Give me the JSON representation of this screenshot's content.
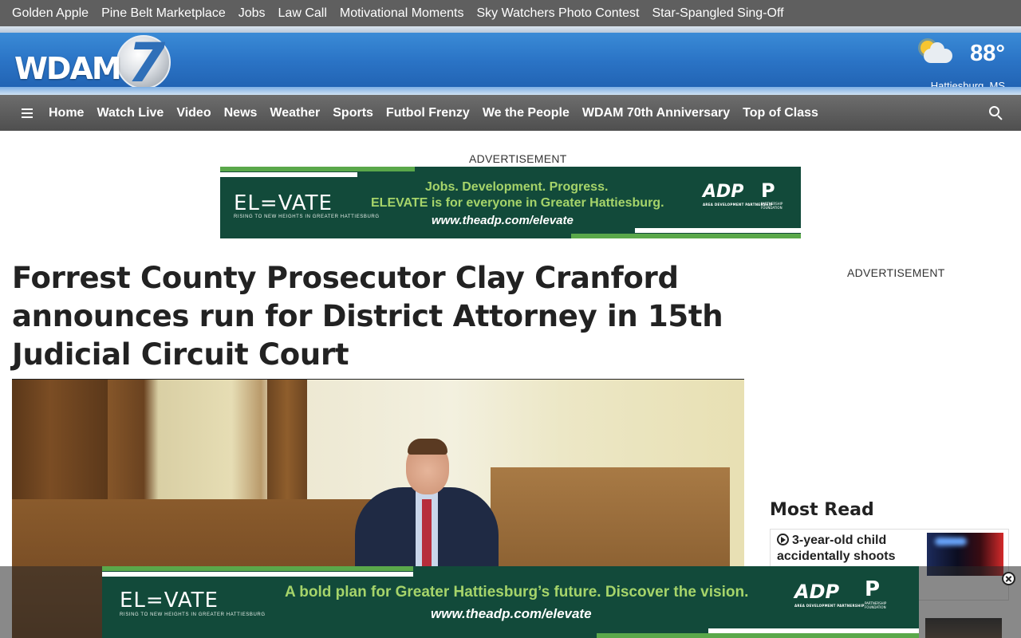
{
  "top_links": [
    "Golden Apple",
    "Pine Belt Marketplace",
    "Jobs",
    "Law Call",
    "Motivational Moments",
    "Sky Watchers Photo Contest",
    "Star-Spangled Sing-Off"
  ],
  "brand": {
    "logo_text": "WDAM",
    "logo_number": "7"
  },
  "weather": {
    "temperature": "88°",
    "location": "Hattiesburg, MS",
    "icon": "partly-cloudy-icon"
  },
  "nav": {
    "menu_icon": "hamburger-menu-icon",
    "items": [
      "Home",
      "Watch Live",
      "Video",
      "News",
      "Weather",
      "Sports",
      "Futbol Frenzy",
      "We the People",
      "WDAM 70th Anniversary",
      "Top of Class"
    ],
    "search_icon": "search-icon"
  },
  "top_ad": {
    "label": "ADVERTISEMENT",
    "brand": "EL=VATE",
    "tagline": "RISING TO NEW HEIGHTS IN GREATER HATTIESBURG",
    "line1": "Jobs. Development. Progress.",
    "line2": "ELEVATE is for everyone in Greater Hattiesburg.",
    "url": "www.theadp.com/elevate",
    "adp": "ADP",
    "adp_sub": "AREA DEVELOPMENT PARTNERSHIP",
    "pf": "P",
    "pf_sub": "PARTNERSHIP FOUNDATION"
  },
  "article": {
    "headline": "Forrest County Prosecutor Clay Cranford announces run for District Attorney in 15th Judicial Circuit Court"
  },
  "sidebar": {
    "ad_label": "ADVERTISEMENT",
    "most_read_title": "Most Read",
    "most_read_items": [
      {
        "title": "3-year-old child accidentally shoots",
        "icon": "play-circle-icon"
      }
    ]
  },
  "sticky_ad": {
    "brand": "EL=VATE",
    "tagline": "RISING TO NEW HEIGHTS IN GREATER HATTIESBURG",
    "line1": "A bold plan for Greater Hattiesburg’s future. Discover the vision.",
    "url": "www.theadp.com/elevate",
    "adp": "ADP",
    "adp_sub": "AREA DEVELOPMENT PARTNERSHIP",
    "pf": "P",
    "pf_sub": "PARTNERSHIP FOUNDATION",
    "close_icon": "close-icon"
  },
  "colors": {
    "ad_green_dark": "#124a3a",
    "ad_green_light": "#a6d46a",
    "nav_gray": "#5a5a5a",
    "brand_blue": "#2b74c6"
  }
}
